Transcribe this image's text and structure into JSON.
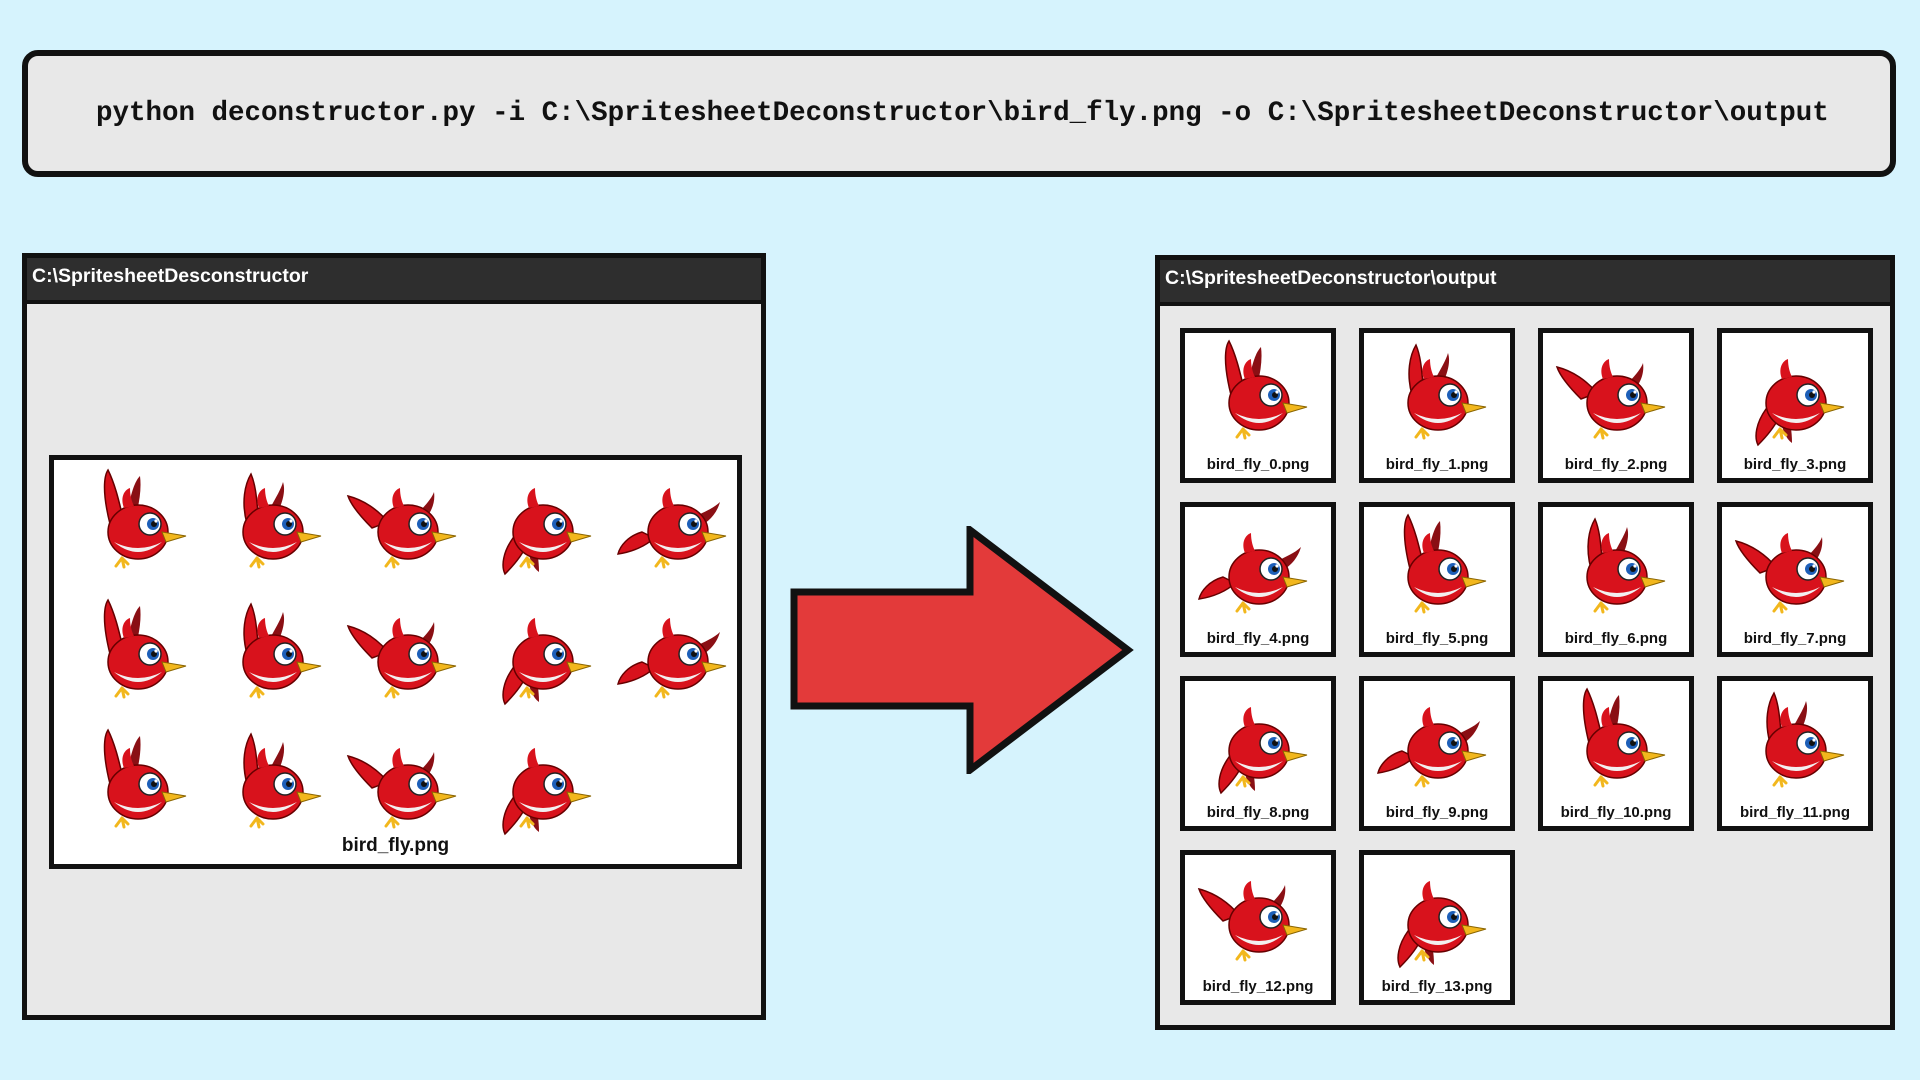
{
  "command": {
    "text": "python deconstructor.py -i C:\\SpritesheetDeconstructor\\bird_fly.png -o C:\\SpritesheetDeconstructor\\output"
  },
  "input_panel": {
    "title": "C:\\SpritesheetDesconstructor",
    "spritesheet": {
      "filename": "bird_fly.png",
      "frame_count": 14
    }
  },
  "output_panel": {
    "title": "C:\\SpritesheetDeconstructor\\output",
    "files": [
      "bird_fly_0.png",
      "bird_fly_1.png",
      "bird_fly_2.png",
      "bird_fly_3.png",
      "bird_fly_4.png",
      "bird_fly_5.png",
      "bird_fly_6.png",
      "bird_fly_7.png",
      "bird_fly_8.png",
      "bird_fly_9.png",
      "bird_fly_10.png",
      "bird_fly_11.png",
      "bird_fly_12.png",
      "bird_fly_13.png"
    ]
  },
  "arrow": {
    "color": "#e33a3a",
    "icon": "right-arrow-icon"
  },
  "colors": {
    "bird": "#d8121c",
    "wing_dark": "#8a0f14",
    "beak": "#f2b71d",
    "background": "#d6f3fd"
  }
}
